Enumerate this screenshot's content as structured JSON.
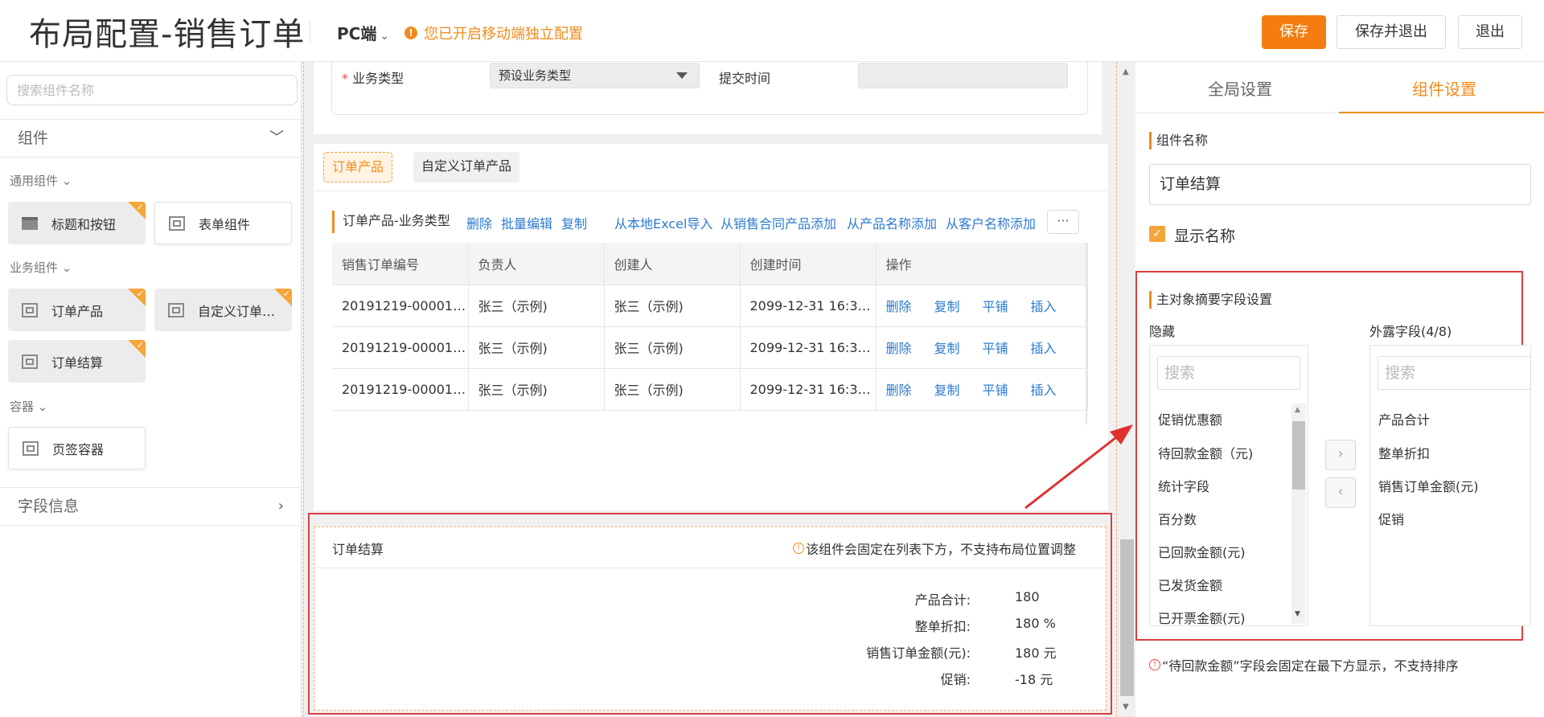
{
  "header": {
    "title": "布局配置-销售订单",
    "mode": "PC端",
    "notice": "您已开启移动端独立配置",
    "save": "保存",
    "save_exit": "保存并退出",
    "exit": "退出"
  },
  "left": {
    "search_placeholder": "搜索组件名称",
    "components_title": "组件",
    "groups": {
      "general": "通用组件",
      "business": "业务组件",
      "container": "容器"
    },
    "items": {
      "title_buttons": "标题和按钮",
      "form": "表单组件",
      "order_products": "订单产品",
      "custom_order": "自定义订单产品",
      "order_summary": "订单结算",
      "tab_container": "页签容器"
    },
    "fields_title": "字段信息"
  },
  "form": {
    "business_type_label": "业务类型",
    "business_type_value": "预设业务类型",
    "submit_time_label": "提交时间"
  },
  "tabs": {
    "active": "订单产品",
    "other": "自定义订单产品"
  },
  "toolbar": {
    "title": "订单产品-业务类型",
    "links": [
      "删除",
      "批量编辑",
      "复制",
      "从本地Excel导入",
      "从销售合同产品添加",
      "从产品名称添加",
      "从客户名称添加"
    ],
    "more": "···"
  },
  "table": {
    "headers": [
      "销售订单编号",
      "负责人",
      "创建人",
      "创建时间",
      "操作"
    ],
    "rows": [
      {
        "id": "20191219-00001…",
        "owner": "张三（示例)",
        "creator": "张三（示例)",
        "time": "2099-12-31 16:31…"
      },
      {
        "id": "20191219-00001…",
        "owner": "张三（示例)",
        "creator": "张三（示例)",
        "time": "2099-12-31 16:31…"
      },
      {
        "id": "20191219-00001…",
        "owner": "张三（示例)",
        "creator": "张三（示例)",
        "time": "2099-12-31 16:31…"
      }
    ],
    "ops": [
      "删除",
      "复制",
      "平铺",
      "插入"
    ]
  },
  "summary": {
    "title": "订单结算",
    "tip": "该组件会固定在列表下方，不支持布局位置调整",
    "rows": [
      {
        "label": "产品合计:",
        "value": "180"
      },
      {
        "label": "整单折扣:",
        "value": "180 %"
      },
      {
        "label": "销售订单金额(元):",
        "value": "180 元"
      },
      {
        "label": "促销:",
        "value": "-18 元"
      }
    ]
  },
  "right": {
    "tab_global": "全局设置",
    "tab_component": "组件设置",
    "name_label": "组件名称",
    "name_value": "订单结算",
    "show_name": "显示名称",
    "summary_fields_label": "主对象摘要字段设置",
    "hidden_label": "隐藏",
    "exposed_label": "外露字段(4/8)",
    "search_placeholder": "搜索",
    "hidden_items": [
      "促销优惠额",
      "待回款金额（元)",
      "统计字段",
      "百分数",
      "已回款金额(元)",
      "已发货金额",
      "已开票金额(元)"
    ],
    "exposed_items": [
      "产品合计",
      "整单折扣",
      "销售订单金额(元)",
      "促销"
    ],
    "footer_tip": "“待回款金额”字段会固定在最下方显示，不支持排序"
  },
  "colors": {
    "accent": "#f57d0f",
    "link": "#2d7bd0",
    "highlight_box": "#d94040"
  }
}
